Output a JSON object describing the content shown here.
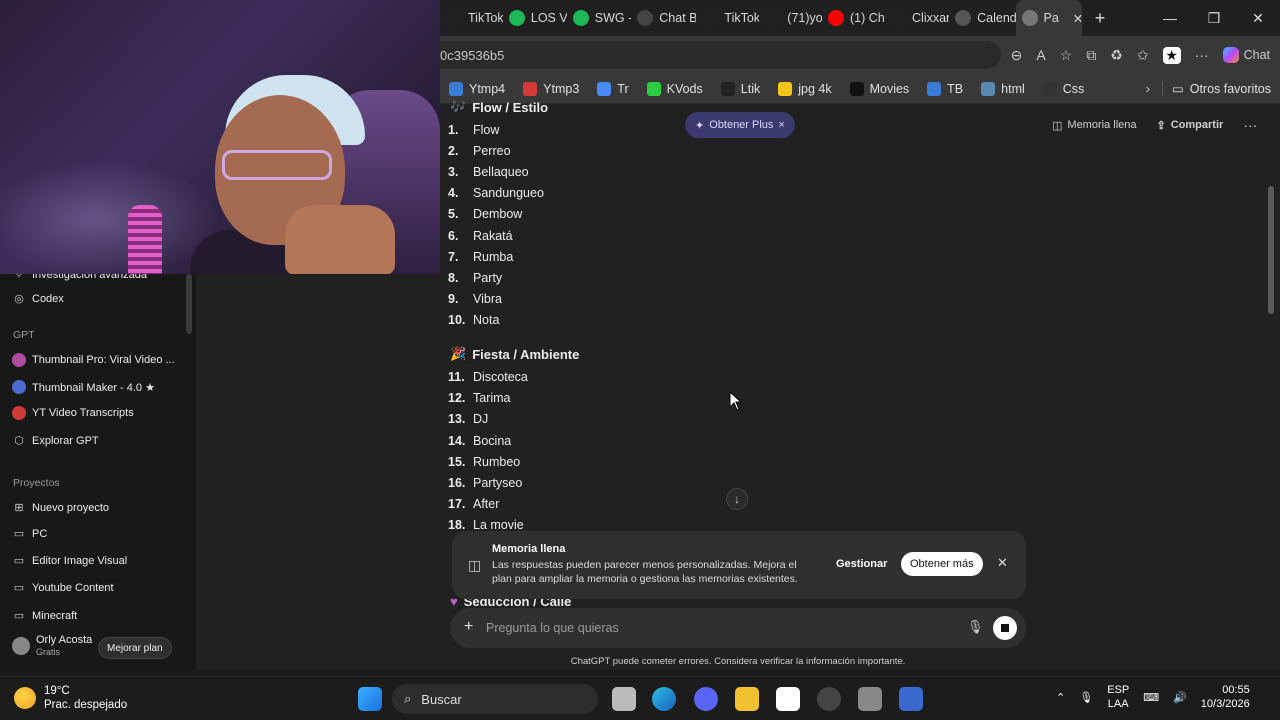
{
  "browser": {
    "tabs": [
      {
        "label": "TikTok",
        "color": "#222222",
        "icon": "tiktok-icon"
      },
      {
        "label": "LOS V",
        "color": "#1db954",
        "icon": "spotify-icon"
      },
      {
        "label": "SWG -",
        "color": "#1db954",
        "icon": "spotify-icon"
      },
      {
        "label": "Chat B",
        "color": "#444444",
        "icon": "chatgpt-icon"
      },
      {
        "label": "TikTok",
        "color": "#222222",
        "icon": "tiktok-icon"
      },
      {
        "label": "(71)yo",
        "color": "#222222",
        "icon": "tiktok-icon"
      },
      {
        "label": "(1) Ch",
        "color": "#ff0000",
        "icon": "youtube-icon"
      },
      {
        "label": "Clixxar",
        "color": "#222222",
        "icon": "tiktok-icon"
      },
      {
        "label": "Calend",
        "color": "#555555",
        "icon": "infinity-icon"
      },
      {
        "label": "Pa",
        "color": "#777777",
        "icon": "chatgpt-icon",
        "active": true
      }
    ],
    "url": "0c39536b5",
    "copilot_label": "Chat",
    "bookmarks": [
      {
        "label": "Ytmp4",
        "color": "#3a7bd5"
      },
      {
        "label": "Ytmp3",
        "color": "#d53a3a"
      },
      {
        "label": "Tr",
        "color": "#4a8af4"
      },
      {
        "label": "KVods",
        "color": "#2ecc40"
      },
      {
        "label": "Ltik",
        "color": "#222222"
      },
      {
        "label": "jpg 4k",
        "color": "#f5c518"
      },
      {
        "label": "Movies",
        "color": "#111111"
      },
      {
        "label": "TB",
        "color": "#3a7bd5"
      },
      {
        "label": "html",
        "color": "#5a8ab0"
      },
      {
        "label": "Css",
        "color": "#333333"
      }
    ],
    "other_favorites": "Otros favoritos"
  },
  "sidebar": {
    "partial_item": "Investigación avanzada",
    "codex": "Codex",
    "gpt_header": "GPT",
    "gpts": [
      {
        "label": "Thumbnail Pro: Viral Video ...",
        "color": "#b04aa0"
      },
      {
        "label": "Thumbnail Maker - 4.0 ★",
        "color": "#4a6ad0"
      },
      {
        "label": "YT Video Transcripts",
        "color": "#d03a3a"
      }
    ],
    "explore": "Explorar GPT",
    "projects_header": "Proyectos",
    "projects": [
      "Nuevo proyecto",
      "PC",
      "Editor Image Visual",
      "Youtube Content",
      "Minecraft"
    ],
    "user_name": "Orly Acosta",
    "user_plan": "Gratis",
    "upgrade": "Mejorar plan"
  },
  "header": {
    "plus_chip": "Obtener Plus",
    "memory": "Memoria llena",
    "share": "Compartir"
  },
  "content": {
    "section1": "Flow / Estilo",
    "list1": [
      {
        "n": "1.",
        "t": "Flow"
      },
      {
        "n": "2.",
        "t": "Perreo"
      },
      {
        "n": "3.",
        "t": "Bellaqueo"
      },
      {
        "n": "4.",
        "t": "Sandungueo"
      },
      {
        "n": "5.",
        "t": "Dembow"
      },
      {
        "n": "6.",
        "t": "Rakatá"
      },
      {
        "n": "7.",
        "t": "Rumba"
      },
      {
        "n": "8.",
        "t": "Party"
      },
      {
        "n": "9.",
        "t": "Vibra"
      },
      {
        "n": "10.",
        "t": "Nota"
      }
    ],
    "section2": "Fiesta / Ambiente",
    "list2": [
      {
        "n": "11.",
        "t": "Discoteca"
      },
      {
        "n": "12.",
        "t": "Tarima"
      },
      {
        "n": "13.",
        "t": "DJ"
      },
      {
        "n": "14.",
        "t": "Bocina"
      },
      {
        "n": "15.",
        "t": "Rumbeo"
      },
      {
        "n": "16.",
        "t": "Partyseo"
      },
      {
        "n": "17.",
        "t": "After"
      },
      {
        "n": "18.",
        "t": "La movie"
      }
    ],
    "section3": "Seducción / Calle"
  },
  "memory_banner": {
    "title": "Memoria llena",
    "desc": "Las respuestas pueden parecer menos personalizadas. Mejora el plan para ampliar la memoria o gestiona las memorias existentes.",
    "manage": "Gestionar",
    "get_more": "Obtener más"
  },
  "composer": {
    "placeholder": "Pregunta lo que quieras",
    "disclaimer": "ChatGPT puede cometer errores. Considera verificar la información importante."
  },
  "taskbar": {
    "temp": "19°C",
    "weather": "Prac. despejado",
    "search": "Buscar",
    "lang1": "ESP",
    "lang2": "LAA",
    "time": "00:55",
    "date": "10/3/2026"
  }
}
